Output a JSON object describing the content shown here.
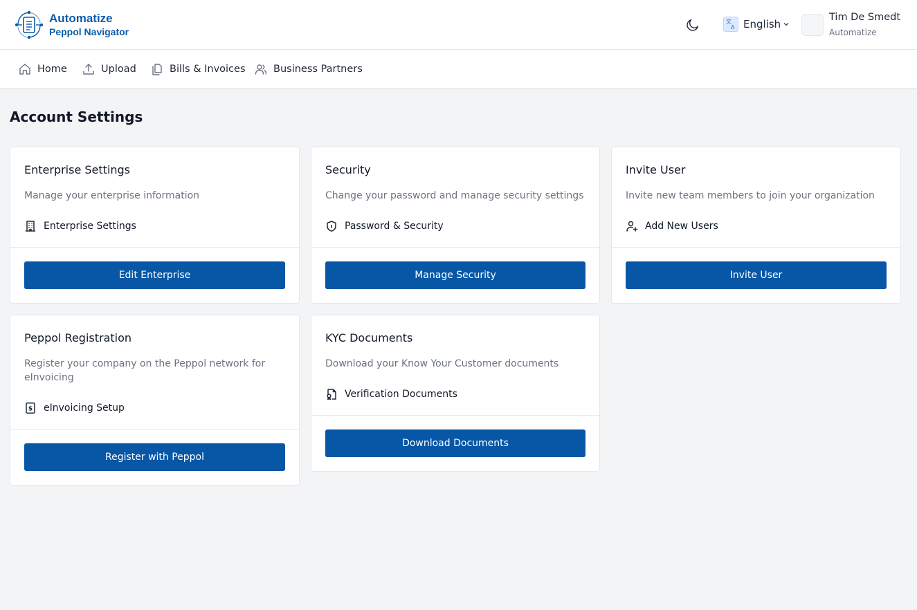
{
  "brand": {
    "name": "Automatize",
    "subtitle": "Peppol Navigator"
  },
  "header": {
    "language": "English",
    "user": {
      "name": "Tim De Smedt",
      "organization": "Automatize"
    }
  },
  "nav": {
    "items": [
      {
        "label": "Home",
        "icon": "home-icon"
      },
      {
        "label": "Upload",
        "icon": "upload-icon"
      },
      {
        "label": "Bills & Invoices",
        "icon": "documents-icon"
      },
      {
        "label": "Business Partners",
        "icon": "users-icon"
      }
    ]
  },
  "page": {
    "title": "Account Settings"
  },
  "cards": [
    {
      "title": "Enterprise Settings",
      "description": "Manage your enterprise information",
      "feature": "Enterprise Settings",
      "feature_icon": "building-icon",
      "button": "Edit Enterprise"
    },
    {
      "title": "Security",
      "description": "Change your password and manage security settings",
      "feature": "Password & Security",
      "feature_icon": "shield-icon",
      "button": "Manage Security"
    },
    {
      "title": "Invite User",
      "description": "Invite new team members to join your organization",
      "feature": "Add New Users",
      "feature_icon": "user-plus-icon",
      "button": "Invite User"
    },
    {
      "title": "Peppol Registration",
      "description": "Register your company on the Peppol network for eInvoicing",
      "feature": "eInvoicing Setup",
      "feature_icon": "receipt-icon",
      "button": "Register with Peppol"
    },
    {
      "title": "KYC Documents",
      "description": "Download your Know Your Customer documents",
      "feature": "Verification Documents",
      "feature_icon": "file-badge-icon",
      "button": "Download Documents"
    }
  ],
  "colors": {
    "brand": "#0b5cad",
    "button": "#0757a6",
    "page_bg": "#f3f4f6",
    "border": "#e5e7eb",
    "muted_text": "#6b7280"
  }
}
